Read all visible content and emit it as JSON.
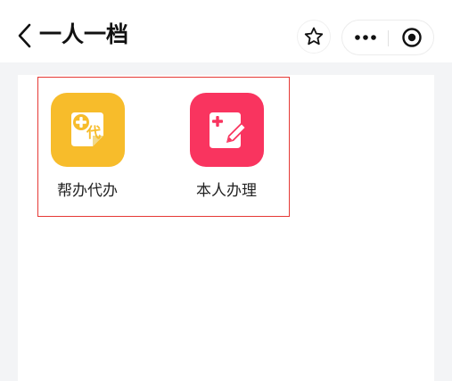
{
  "header": {
    "title": "一人一档",
    "back_icon": "chevron-left-icon",
    "favorite_icon": "star-outline-icon",
    "more_icon": "ellipsis-icon",
    "close_icon": "target-circle-icon"
  },
  "services": [
    {
      "label": "帮办代办",
      "icon": "plus-document-agent-icon",
      "icon_text": "代",
      "color": "#f7bc2b"
    },
    {
      "label": "本人办理",
      "icon": "plus-document-edit-icon",
      "color": "#f9345f"
    }
  ],
  "colors": {
    "highlight_border": "#e53935",
    "page_background": "#f3f4f6"
  }
}
